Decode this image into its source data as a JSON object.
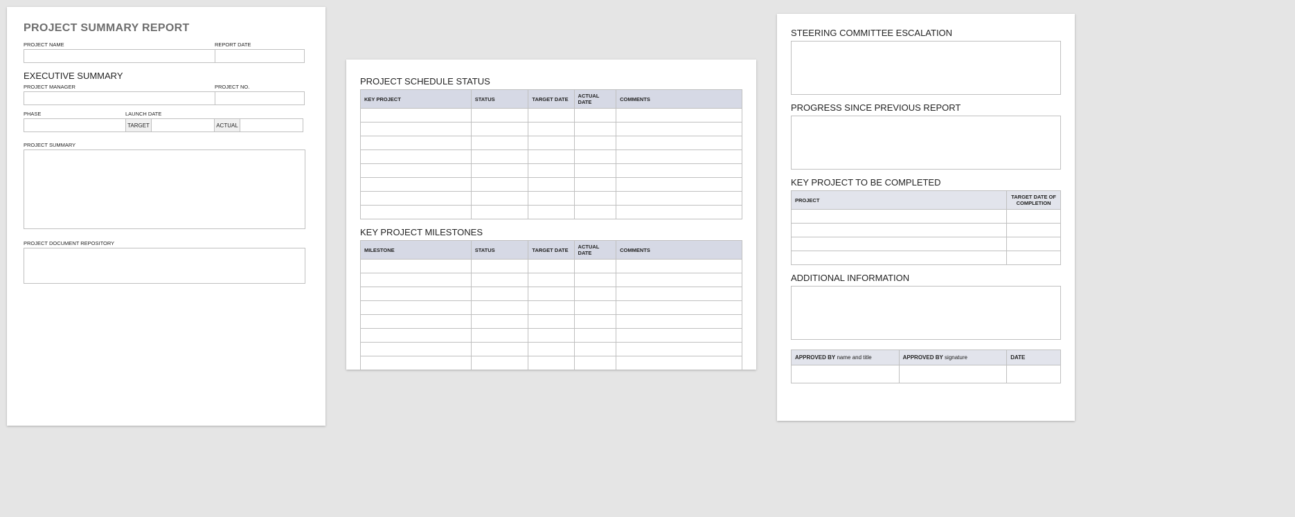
{
  "page1": {
    "title": "PROJECT SUMMARY REPORT",
    "project_name_label": "PROJECT NAME",
    "report_date_label": "REPORT DATE",
    "exec_summary_heading": "EXECUTIVE SUMMARY",
    "project_manager_label": "PROJECT MANAGER",
    "project_no_label": "PROJECT NO.",
    "phase_label": "PHASE",
    "launch_date_label": "LAUNCH DATE",
    "target_label": "TARGET",
    "actual_label": "ACTUAL",
    "project_summary_label": "PROJECT SUMMARY",
    "project_doc_repo_label": "PROJECT DOCUMENT REPOSITORY"
  },
  "page2": {
    "schedule_heading": "PROJECT SCHEDULE STATUS",
    "schedule_cols": {
      "c1": "KEY PROJECT",
      "c2": "STATUS",
      "c3": "TARGET DATE",
      "c4": "ACTUAL DATE",
      "c5": "COMMENTS"
    },
    "schedule_row_count": 8,
    "milestones_heading": "KEY PROJECT MILESTONES",
    "milestone_cols": {
      "c1": "MILESTONE",
      "c2": "STATUS",
      "c3": "TARGET DATE",
      "c4": "ACTUAL DATE",
      "c5": "COMMENTS"
    },
    "milestone_row_count": 8
  },
  "page3": {
    "steering_heading": "STEERING COMMITTEE ESCALATION",
    "progress_heading": "PROGRESS SINCE PREVIOUS REPORT",
    "key_complete_heading": "KEY PROJECT TO BE COMPLETED",
    "key_complete_cols": {
      "c1": "PROJECT",
      "c2": "TARGET DATE OF COMPLETION"
    },
    "key_complete_row_count": 4,
    "additional_heading": "ADDITIONAL INFORMATION",
    "approve": {
      "by_bold": "APPROVED BY",
      "by_sub": " name and title",
      "sig_bold": "APPROVED BY",
      "sig_sub": " signature",
      "date": "DATE"
    }
  }
}
